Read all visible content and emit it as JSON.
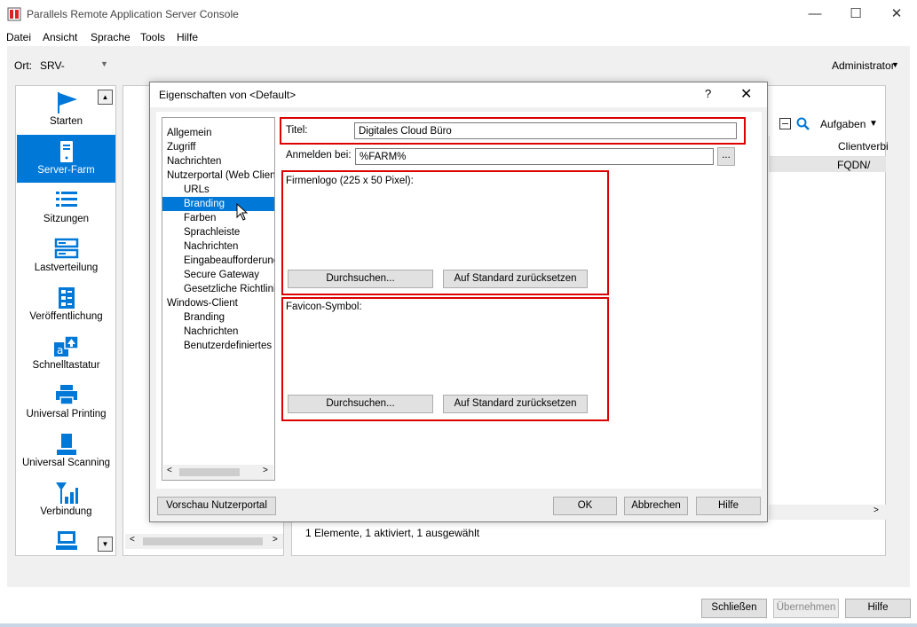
{
  "app": {
    "title": "Parallels Remote Application Server Console",
    "window_minimize": "—",
    "window_maximize": "☐",
    "window_close": "✕"
  },
  "menu": [
    "Datei",
    "Ansicht",
    "Sprache",
    "Tools",
    "Hilfe"
  ],
  "header": {
    "ort_label": "Ort:",
    "ort_value": "SRV-",
    "admin_label": "Administrator"
  },
  "nav": {
    "items": [
      {
        "label": "Starten",
        "icon": "flag-icon",
        "selected": false
      },
      {
        "label": "Server-Farm",
        "icon": "server-farm-icon",
        "selected": true
      },
      {
        "label": "Sitzungen",
        "icon": "sessions-icon",
        "selected": false
      },
      {
        "label": "Lastverteilung",
        "icon": "load-balancing-icon",
        "selected": false
      },
      {
        "label": "Veröffentlichung",
        "icon": "publishing-icon",
        "selected": false
      },
      {
        "label": "Schnelltastatur",
        "icon": "keyboard-icon",
        "selected": false
      },
      {
        "label": "Universal Printing",
        "icon": "printer-icon",
        "selected": false
      },
      {
        "label": "Universal Scanning",
        "icon": "scanner-icon",
        "selected": false
      },
      {
        "label": "Verbindung",
        "icon": "connection-icon",
        "selected": false
      },
      {
        "label": "",
        "icon": "computer-icon",
        "selected": false
      }
    ]
  },
  "right_panel": {
    "tasks_label": "Aufgaben",
    "column_header": "Clientverbi",
    "cell_value": "FQDN/",
    "status_text": "1 Elemente, 1 aktiviert, 1 ausgewählt"
  },
  "dialog": {
    "title": "Eigenschaften von <Default>",
    "help": "?",
    "close": "✕",
    "tree": [
      {
        "label": "Allgemein",
        "level": 0,
        "selected": false
      },
      {
        "label": "Zugriff",
        "level": 0,
        "selected": false
      },
      {
        "label": "Nachrichten",
        "level": 0,
        "selected": false
      },
      {
        "label": "Nutzerportal (Web Client)",
        "level": 0,
        "selected": false
      },
      {
        "label": "URLs",
        "level": 1,
        "selected": false
      },
      {
        "label": "Branding",
        "level": 1,
        "selected": true
      },
      {
        "label": "Farben",
        "level": 1,
        "selected": false
      },
      {
        "label": "Sprachleiste",
        "level": 1,
        "selected": false
      },
      {
        "label": "Nachrichten",
        "level": 1,
        "selected": false
      },
      {
        "label": "Eingabeaufforderung",
        "level": 1,
        "selected": false
      },
      {
        "label": "Secure Gateway",
        "level": 1,
        "selected": false
      },
      {
        "label": "Gesetzliche Richtlinien",
        "level": 1,
        "selected": false
      },
      {
        "label": "Windows-Client",
        "level": 0,
        "selected": false
      },
      {
        "label": "Branding",
        "level": 1,
        "selected": false
      },
      {
        "label": "Nachrichten",
        "level": 1,
        "selected": false
      },
      {
        "label": "Benutzerdefiniertes M",
        "level": 1,
        "selected": false
      }
    ],
    "title_label": "Titel:",
    "title_value": "Digitales Cloud Büro",
    "login_label": "Anmelden bei:",
    "login_value": "%FARM%",
    "browse_small": "...",
    "logo_label": "Firmenlogo (225 x 50 Pixel):",
    "favicon_label": "Favicon-Symbol:",
    "browse_label": "Durchsuchen...",
    "reset_label": "Auf Standard zurücksetzen",
    "preview_label": "Vorschau Nutzerportal",
    "ok_label": "OK",
    "cancel_label": "Abbrechen",
    "help_label": "Hilfe"
  },
  "footer": {
    "close_label": "Schließen",
    "apply_label": "Übernehmen",
    "help_label": "Hilfe"
  }
}
